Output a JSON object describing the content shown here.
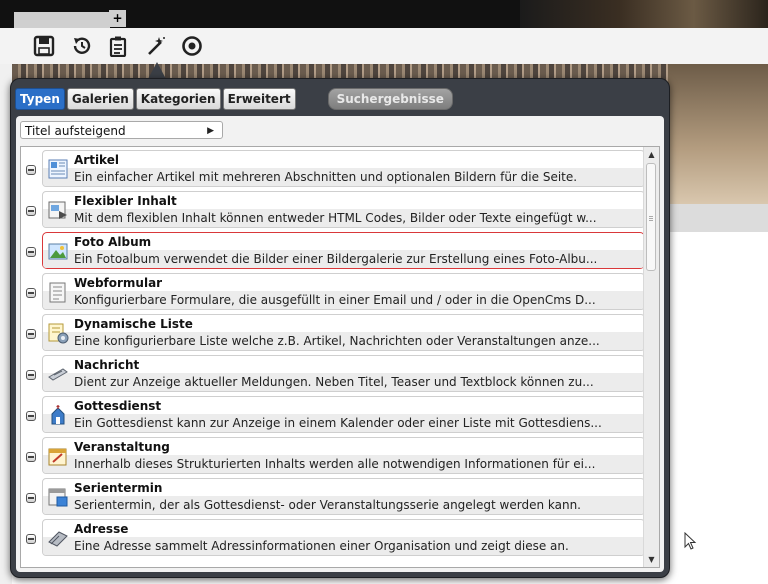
{
  "window": {
    "plus_tab": "+"
  },
  "toolbar": {
    "buttons": [
      "save-icon",
      "history-icon",
      "clipboard-icon",
      "magic-wand-icon",
      "target-icon"
    ]
  },
  "dialog": {
    "tabs": [
      {
        "label": "Typen",
        "active": true
      },
      {
        "label": "Galerien",
        "active": false
      },
      {
        "label": "Kategorien",
        "active": false
      },
      {
        "label": "Erweitert",
        "active": false
      }
    ],
    "search_results_tab": "Suchergebnisse",
    "sort": {
      "selected": "Titel aufsteigend"
    },
    "items": [
      {
        "title": "Artikel",
        "description": "Ein einfacher Artikel mit mehreren Abschnitten und optionalen Bildern für die Seite.",
        "icon": "article-icon",
        "selected": false
      },
      {
        "title": "Flexibler Inhalt",
        "description": "Mit dem flexiblen Inhalt können entweder HTML Codes, Bilder oder Texte eingefügt w...",
        "icon": "flexible-content-icon",
        "selected": false
      },
      {
        "title": "Foto Album",
        "description": "Ein Fotoalbum verwendet die Bilder einer Bildergalerie zur Erstellung eines Foto-Albu...",
        "icon": "photo-album-icon",
        "selected": true
      },
      {
        "title": "Webformular",
        "description": "Konfigurierbare Formulare, die ausgefüllt in einer Email und / oder in die OpenCms D...",
        "icon": "webform-icon",
        "selected": false
      },
      {
        "title": "Dynamische Liste",
        "description": "Eine konfigurierbare Liste welche z.B. Artikel, Nachrichten oder Veranstaltungen anze...",
        "icon": "dynamic-list-icon",
        "selected": false
      },
      {
        "title": "Nachricht",
        "description": "Dient zur Anzeige aktueller Meldungen. Neben Titel, Teaser und Textblock können zu...",
        "icon": "news-icon",
        "selected": false
      },
      {
        "title": "Gottesdienst",
        "description": "Ein Gottesdienst kann zur Anzeige in einem Kalender oder einer Liste mit Gottesdiens...",
        "icon": "church-icon",
        "selected": false
      },
      {
        "title": "Veranstaltung",
        "description": "Innerhalb dieses Strukturierten Inhalts werden alle notwendigen Informationen für ei...",
        "icon": "event-icon",
        "selected": false
      },
      {
        "title": "Serientermin",
        "description": "Serientermin, der als Gottesdienst- oder Veranstaltungsserie angelegt werden kann.",
        "icon": "series-event-icon",
        "selected": false
      },
      {
        "title": "Adresse",
        "description": "Eine Adresse sammelt Adressinformationen einer Organisation und zeigt diese an.",
        "icon": "address-icon",
        "selected": false
      }
    ]
  }
}
